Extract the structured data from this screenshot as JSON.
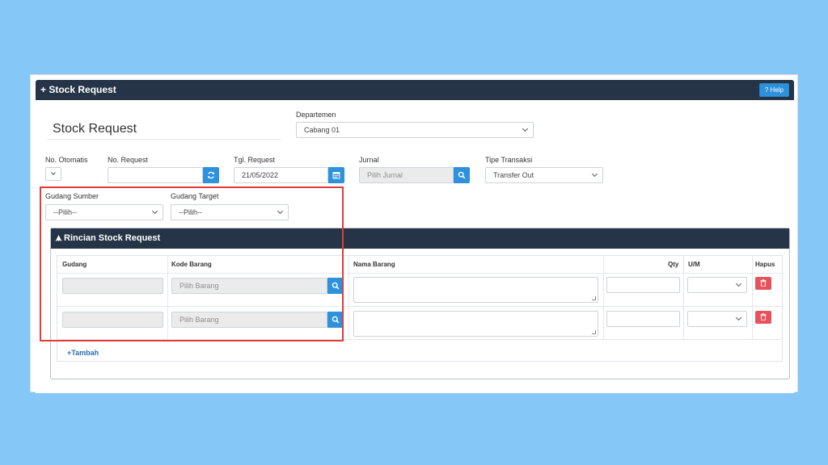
{
  "header": {
    "title": "+ Stock Request",
    "help_label": "? Help"
  },
  "page_title": "Stock Request",
  "form": {
    "departemen": {
      "label": "Departemen",
      "value": "Cabang 01"
    },
    "no_otomatis": {
      "label": "No. Otomatis",
      "value": ""
    },
    "no_request": {
      "label": "No. Request",
      "value": ""
    },
    "tgl_request": {
      "label": "Tgl. Request",
      "value": "21/05/2022"
    },
    "jurnal": {
      "label": "Jurnal",
      "placeholder": "Pilih Jurnal"
    },
    "tipe_transaksi": {
      "label": "Tipe Transaksi",
      "value": "Transfer Out"
    },
    "gudang_sumber": {
      "label": "Gudang Sumber",
      "value": "--Pilih--"
    },
    "gudang_target": {
      "label": "Gudang Target",
      "value": "--Pilih--"
    }
  },
  "detail": {
    "title": "Rincian Stock Request",
    "columns": {
      "gudang": "Gudang",
      "kode_barang": "Kode Barang",
      "nama_barang": "Nama Barang",
      "qty": "Qty",
      "um": "U/M",
      "hapus": "Hapus"
    },
    "rows": [
      {
        "gudang": "",
        "kode_barang_placeholder": "Pilih Barang",
        "nama_barang": "",
        "qty": "",
        "um": ""
      },
      {
        "gudang": "",
        "kode_barang_placeholder": "Pilih Barang",
        "nama_barang": "",
        "qty": "",
        "um": ""
      }
    ],
    "add_label": "+Tambah"
  },
  "colors": {
    "header_bg": "#253446",
    "primary": "#2d91dc",
    "danger": "#e8525c",
    "highlight": "#e23b3b",
    "page_bg": "#85c7f6"
  },
  "icons": {
    "refresh": "refresh-icon",
    "calendar": "calendar-icon",
    "search": "search-icon",
    "trash": "trash-icon",
    "section": "rocket-icon"
  }
}
